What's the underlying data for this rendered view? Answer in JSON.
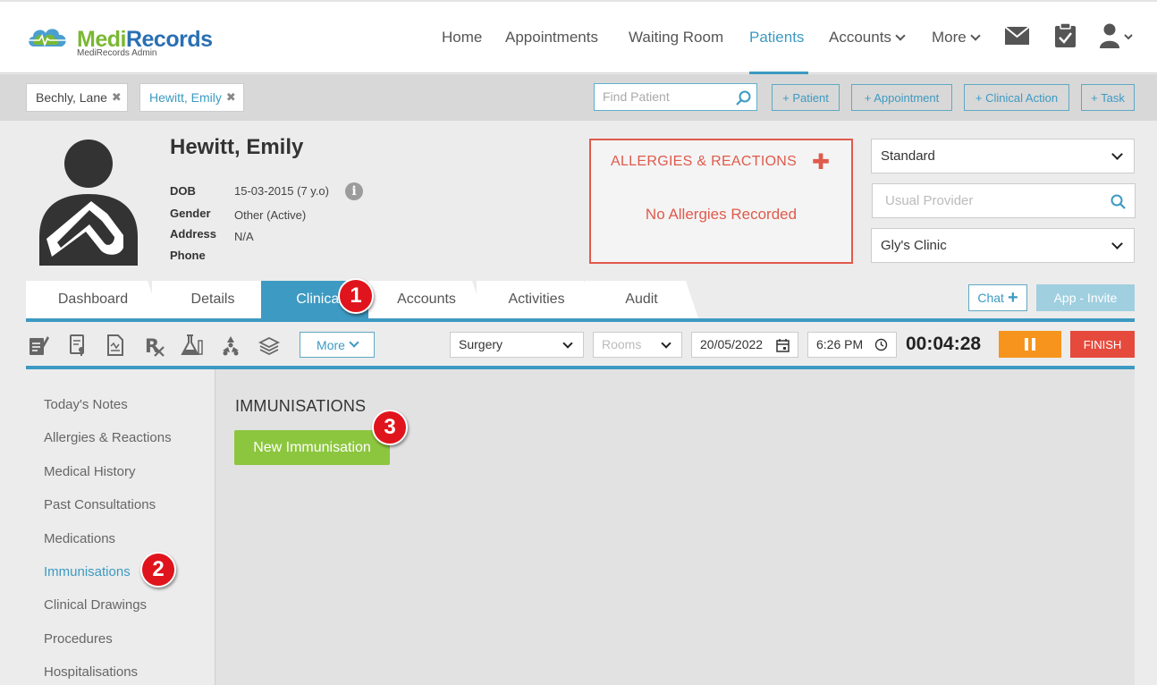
{
  "brand": {
    "name_part1": "Medi",
    "name_part2": "Records",
    "subtitle": "MediRecords Admin"
  },
  "nav": {
    "home": "Home",
    "appointments": "Appointments",
    "waiting_room": "Waiting Room",
    "patients": "Patients",
    "accounts": "Accounts",
    "more": "More"
  },
  "open_patients": [
    {
      "name": "Bechly, Lane"
    },
    {
      "name": "Hewitt, Emily"
    }
  ],
  "tab_close_glyph": "✖",
  "find_patient_placeholder": "Find Patient",
  "quick_actions": {
    "patient": "+ Patient",
    "appointment": "+ Appointment",
    "clinical_action": "+ Clinical Action",
    "task": "+ Task"
  },
  "patient": {
    "name": "Hewitt, Emily",
    "dob_label": "DOB",
    "dob_value": "15-03-2015 (7 y.o)",
    "gender_label": "Gender",
    "gender_value": "Other (Active)",
    "address_label": "Address",
    "address_value": "N/A",
    "phone_label": "Phone",
    "phone_value": ""
  },
  "allergies": {
    "title": "ALLERGIES & REACTIONS",
    "add_glyph": "✚",
    "empty_text": "No Allergies Recorded"
  },
  "right_panel": {
    "status_value": "Standard",
    "usual_provider_placeholder": "Usual Provider",
    "clinic_value": "Gly's Clinic"
  },
  "tabs": [
    "Dashboard",
    "Details",
    "Clinical",
    "Accounts",
    "Activities",
    "Audit"
  ],
  "active_tab": "Clinical",
  "chat_label": "Chat",
  "chat_plus": "+",
  "app_invite_label": "App - Invite",
  "toolbar": {
    "more_label": "More",
    "location_value": "Surgery",
    "rooms_placeholder": "Rooms",
    "date_value": "20/05/2022",
    "time_value": "6:26 PM",
    "timer_value": "00:04:28",
    "finish_label": "FINISH"
  },
  "sidebar": {
    "items": [
      "Today's Notes",
      "Allergies & Reactions",
      "Medical History",
      "Past Consultations",
      "Medications",
      "Immunisations",
      "Clinical Drawings",
      "Procedures",
      "Hospitalisations"
    ],
    "active": "Immunisations"
  },
  "main": {
    "section_title": "IMMUNISATIONS",
    "new_button": "New Immunisation"
  },
  "annotations": [
    "1",
    "2",
    "3"
  ],
  "colors": {
    "accent": "#3d9ac2",
    "brand_green": "#7ab833",
    "brand_blue": "#2a6fb3",
    "alert_red": "#e05a4c",
    "pause_orange": "#f7941d",
    "finish_red": "#e64a3c",
    "new_green": "#8cc63f",
    "badge_red": "#e0141c"
  }
}
